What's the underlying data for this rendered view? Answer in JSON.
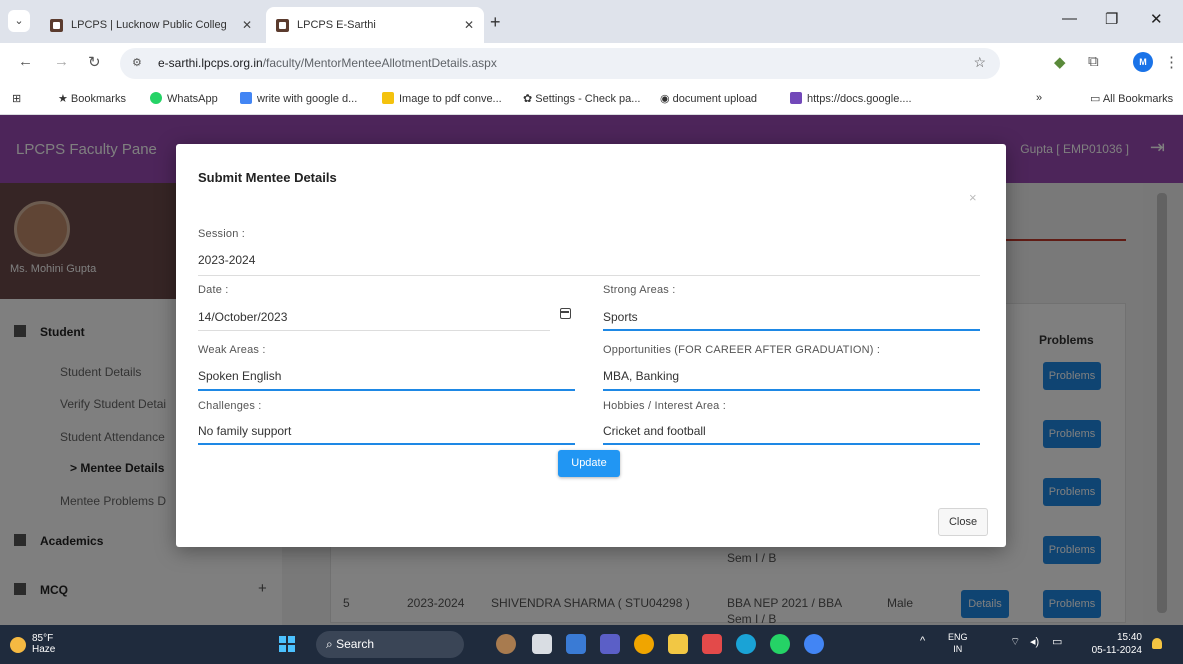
{
  "browser": {
    "tabs": [
      {
        "title": "LPCPS | Lucknow Public Colleg",
        "active": false
      },
      {
        "title": "LPCPS E-Sarthi",
        "active": true
      }
    ],
    "url_domain": "e-sarthi.lpcps.org.in",
    "url_path": "/faculty/MentorMenteeAllotmentDetails.aspx",
    "bookmarks": [
      {
        "label": "Bookmarks",
        "color": "#202124"
      },
      {
        "label": "WhatsApp",
        "color": "#25d366"
      },
      {
        "label": "write with google d...",
        "color": "#4285f4"
      },
      {
        "label": "Image to pdf conve...",
        "color": "#f4c20d"
      },
      {
        "label": "Settings - Check pa...",
        "color": "#444444"
      },
      {
        "label": "document upload",
        "color": "#333333"
      },
      {
        "label": "https://docs.google....",
        "color": "#7248b9"
      }
    ],
    "all_bookmarks": "All Bookmarks",
    "profile_initial": "M"
  },
  "app": {
    "panel_title": "LPCPS Faculty Pane",
    "user_label": "Gupta [ EMP01036 ]",
    "profile_name": "Ms. Mohini Gupta",
    "sidebar": {
      "student_heading": "Student",
      "items": [
        "Student Details",
        "Verify Student Detai",
        "Student Attendance",
        "> Mentee Details",
        "Mentee Problems D"
      ],
      "academics_heading": "Academics",
      "mcq_heading": "MCQ",
      "plus": "+"
    },
    "table": {
      "problems_header": "Problems",
      "details_btn": "Details",
      "problems_btn": "Problems",
      "row5": {
        "no": "5",
        "session": "2023-2024",
        "name": "SHIVENDRA SHARMA ( STU04298 )",
        "course": "BBA NEP 2021 / BBA",
        "sem": "Sem I / B",
        "gender": "Male"
      },
      "row4_sem": "Sem I / B"
    }
  },
  "modal": {
    "title": "Submit Mentee Details",
    "close_x": "×",
    "session_label": "Session :",
    "session_value": "2023-2024",
    "date_label": "Date :",
    "date_value": "14/October/2023",
    "strong_label": "Strong Areas :",
    "strong_value": "Sports",
    "weak_label": "Weak Areas :",
    "weak_value": "Spoken English",
    "opp_label": "Opportunities (FOR CAREER AFTER GRADUATION) :",
    "opp_value": "MBA, Banking",
    "challenges_label": "Challenges :",
    "challenges_value": "No family support",
    "hobbies_label": "Hobbies / Interest Area :",
    "hobbies_value": "Cricket and football",
    "update_btn": "Update",
    "close_btn": "Close"
  },
  "taskbar": {
    "temp": "85°F",
    "weather": "Haze",
    "search": "Search",
    "lang_top": "ENG",
    "lang_bottom": "IN",
    "time": "15:40",
    "date": "05-11-2024"
  }
}
